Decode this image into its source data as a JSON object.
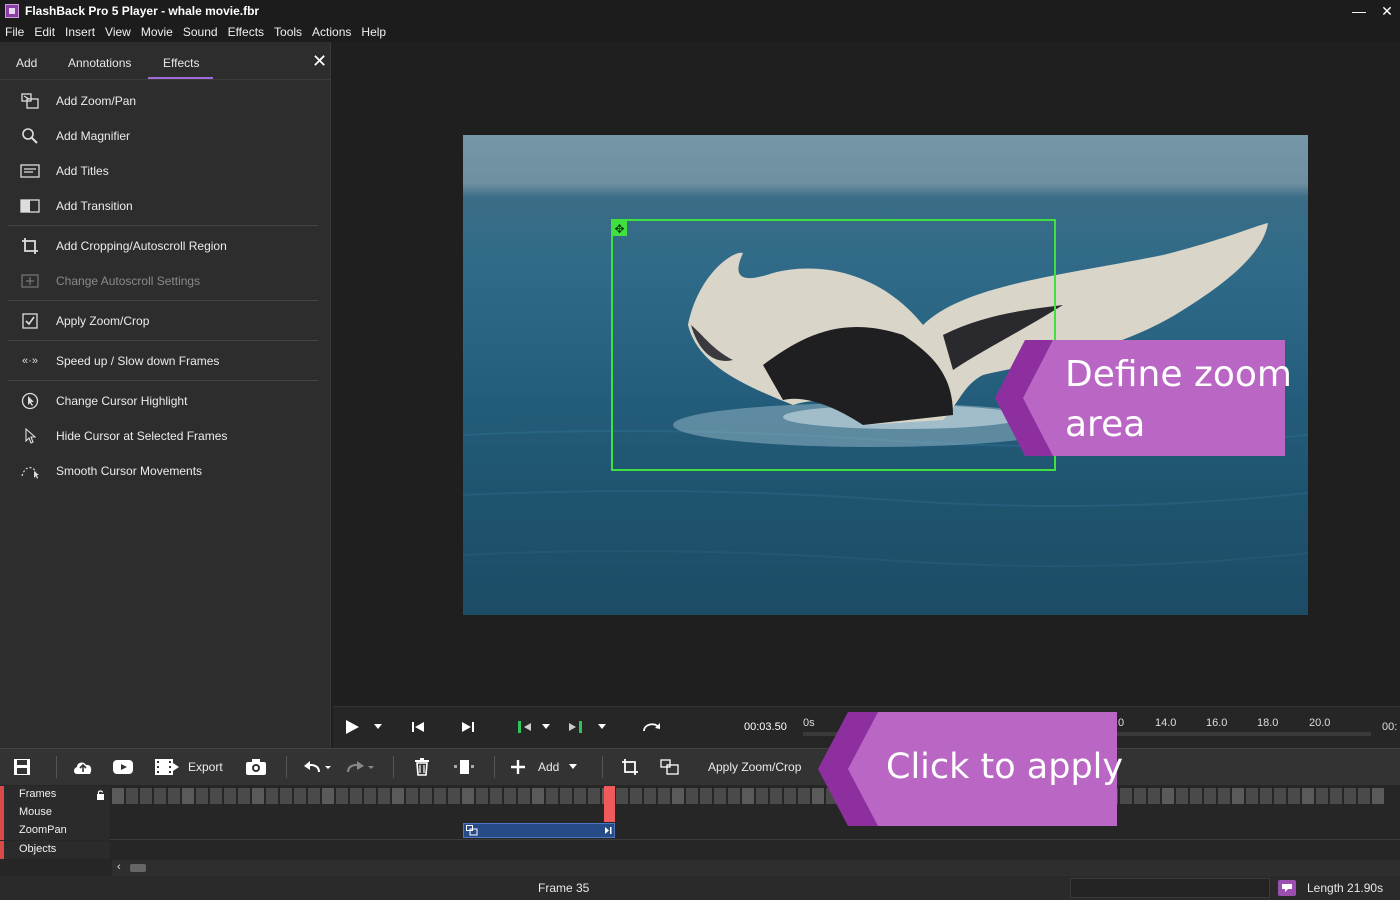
{
  "window": {
    "title": "FlashBack Pro 5 Player - whale movie.fbr",
    "minimize": "—",
    "close": "✕"
  },
  "menu": [
    "File",
    "Edit",
    "Insert",
    "View",
    "Movie",
    "Sound",
    "Effects",
    "Tools",
    "Actions",
    "Help"
  ],
  "panel": {
    "tabs": [
      "Add",
      "Annotations",
      "Effects"
    ],
    "active_tab": "Effects",
    "close_label": "✕",
    "items": [
      {
        "label": "Add Zoom/Pan",
        "icon": "zoom-pan-icon"
      },
      {
        "label": "Add Magnifier",
        "icon": "magnifier-icon"
      },
      {
        "label": "Add Titles",
        "icon": "titles-icon"
      },
      {
        "label": "Add Transition",
        "icon": "transition-icon"
      },
      {
        "label": "Add Cropping/Autoscroll Region",
        "icon": "crop-icon"
      },
      {
        "label": "Change Autoscroll Settings",
        "icon": "autoscroll-icon",
        "disabled": true
      },
      {
        "label": "Apply Zoom/Crop",
        "icon": "checkbox-icon"
      },
      {
        "label": "Speed up / Slow down Frames",
        "icon": "speed-icon"
      },
      {
        "label": "Change Cursor Highlight",
        "icon": "cursor-highlight-icon"
      },
      {
        "label": "Hide Cursor at Selected Frames",
        "icon": "cursor-icon"
      },
      {
        "label": "Smooth Cursor Movements",
        "icon": "smooth-cursor-icon"
      }
    ]
  },
  "callouts": {
    "zoom_line1": "Define zoom",
    "zoom_line2": "area",
    "apply": "Click to apply",
    "color": "#b05ab8"
  },
  "player": {
    "time": "00:03.50",
    "ruler": [
      "0s",
      ".0",
      "14.0",
      "16.0",
      "18.0",
      "20.0",
      "00:"
    ]
  },
  "toolbar": {
    "export": "Export",
    "add": "Add",
    "apply_zoom_crop": "Apply Zoom/Crop"
  },
  "tracks": [
    "Frames",
    "Mouse",
    "ZoomPan",
    "Objects"
  ],
  "status": {
    "frame": "Frame 35",
    "length": "Length 21.90s"
  },
  "colors": {
    "accent": "#a06bd8",
    "zoom_rect": "#3fe03f",
    "cursor_marker": "#f05a5a",
    "track_bar": "#d94a4a"
  }
}
